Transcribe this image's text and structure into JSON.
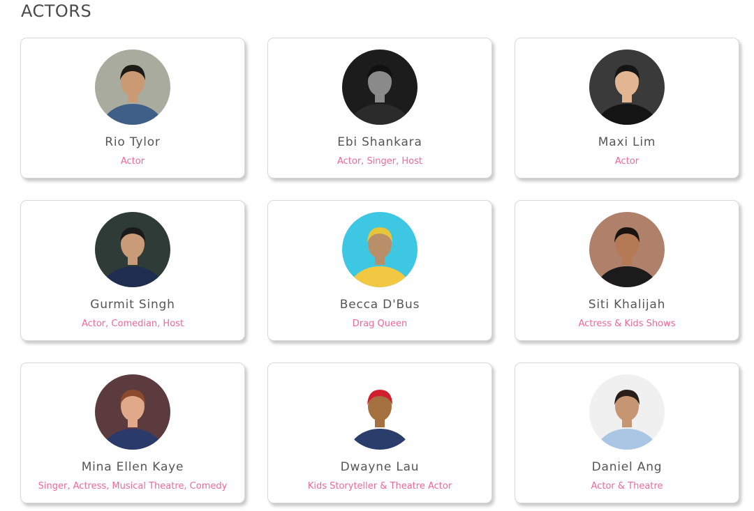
{
  "section": {
    "title": "ACTORS"
  },
  "cards": [
    {
      "name": "Rio Tylor",
      "role": "Actor",
      "photo": "rio-tylor-photo",
      "palette": {
        "bg": "#a8ab9e",
        "skin": "#c99a74",
        "hair": "#1e1a16",
        "outfit": "#3f5f86"
      }
    },
    {
      "name": "Ebi Shankara",
      "role": "Actor, Singer, Host",
      "photo": "ebi-shankara-photo",
      "palette": {
        "bg": "#1c1c1c",
        "skin": "#8a8a8a",
        "hair": "#111111",
        "outfit": "#2b2b2b"
      }
    },
    {
      "name": "Maxi Lim",
      "role": "Actor",
      "photo": "maxi-lim-photo",
      "palette": {
        "bg": "#3a3a3a",
        "skin": "#e2b692",
        "hair": "#151515",
        "outfit": "#141414"
      }
    },
    {
      "name": "Gurmit Singh",
      "role": "Actor, Comedian, Host",
      "photo": "gurmit-singh-photo",
      "palette": {
        "bg": "#2f3b36",
        "skin": "#c99b78",
        "hair": "#1a1a1a",
        "outfit": "#1f2e4f"
      }
    },
    {
      "name": "Becca D'Bus",
      "role": "Drag Queen",
      "photo": "becca-dbus-photo",
      "palette": {
        "bg": "#3ec7e3",
        "skin": "#b98f6a",
        "hair": "#e7c53a",
        "outfit": "#f2c843"
      }
    },
    {
      "name": "Siti Khalijah",
      "role": "Actress & Kids Shows",
      "photo": "siti-khalijah-photo",
      "palette": {
        "bg": "#b0816a",
        "skin": "#b47a56",
        "hair": "#1a1410",
        "outfit": "#1b1b1b"
      }
    },
    {
      "name": "Mina Ellen Kaye",
      "role": "Singer, Actress, Musical Theatre, Comedy",
      "photo": "mina-ellen-kaye-photo",
      "palette": {
        "bg": "#5c3b3e",
        "skin": "#e0a98a",
        "hair": "#8b4a2c",
        "outfit": "#2a3a6b"
      }
    },
    {
      "name": "Dwayne Lau",
      "role": "Kids Storyteller & Theatre Actor",
      "photo": "dwayne-lau-photo",
      "palette": {
        "bg": "#ffffff",
        "skin": "#a5703f",
        "hair": "#cf1e2e",
        "outfit": "#2a3d6b"
      }
    },
    {
      "name": "Daniel Ang",
      "role": "Actor & Theatre",
      "photo": "daniel-ang-photo",
      "palette": {
        "bg": "#f0f0f0",
        "skin": "#c69673",
        "hair": "#2a1f18",
        "outfit": "#a9c6e4"
      }
    }
  ]
}
